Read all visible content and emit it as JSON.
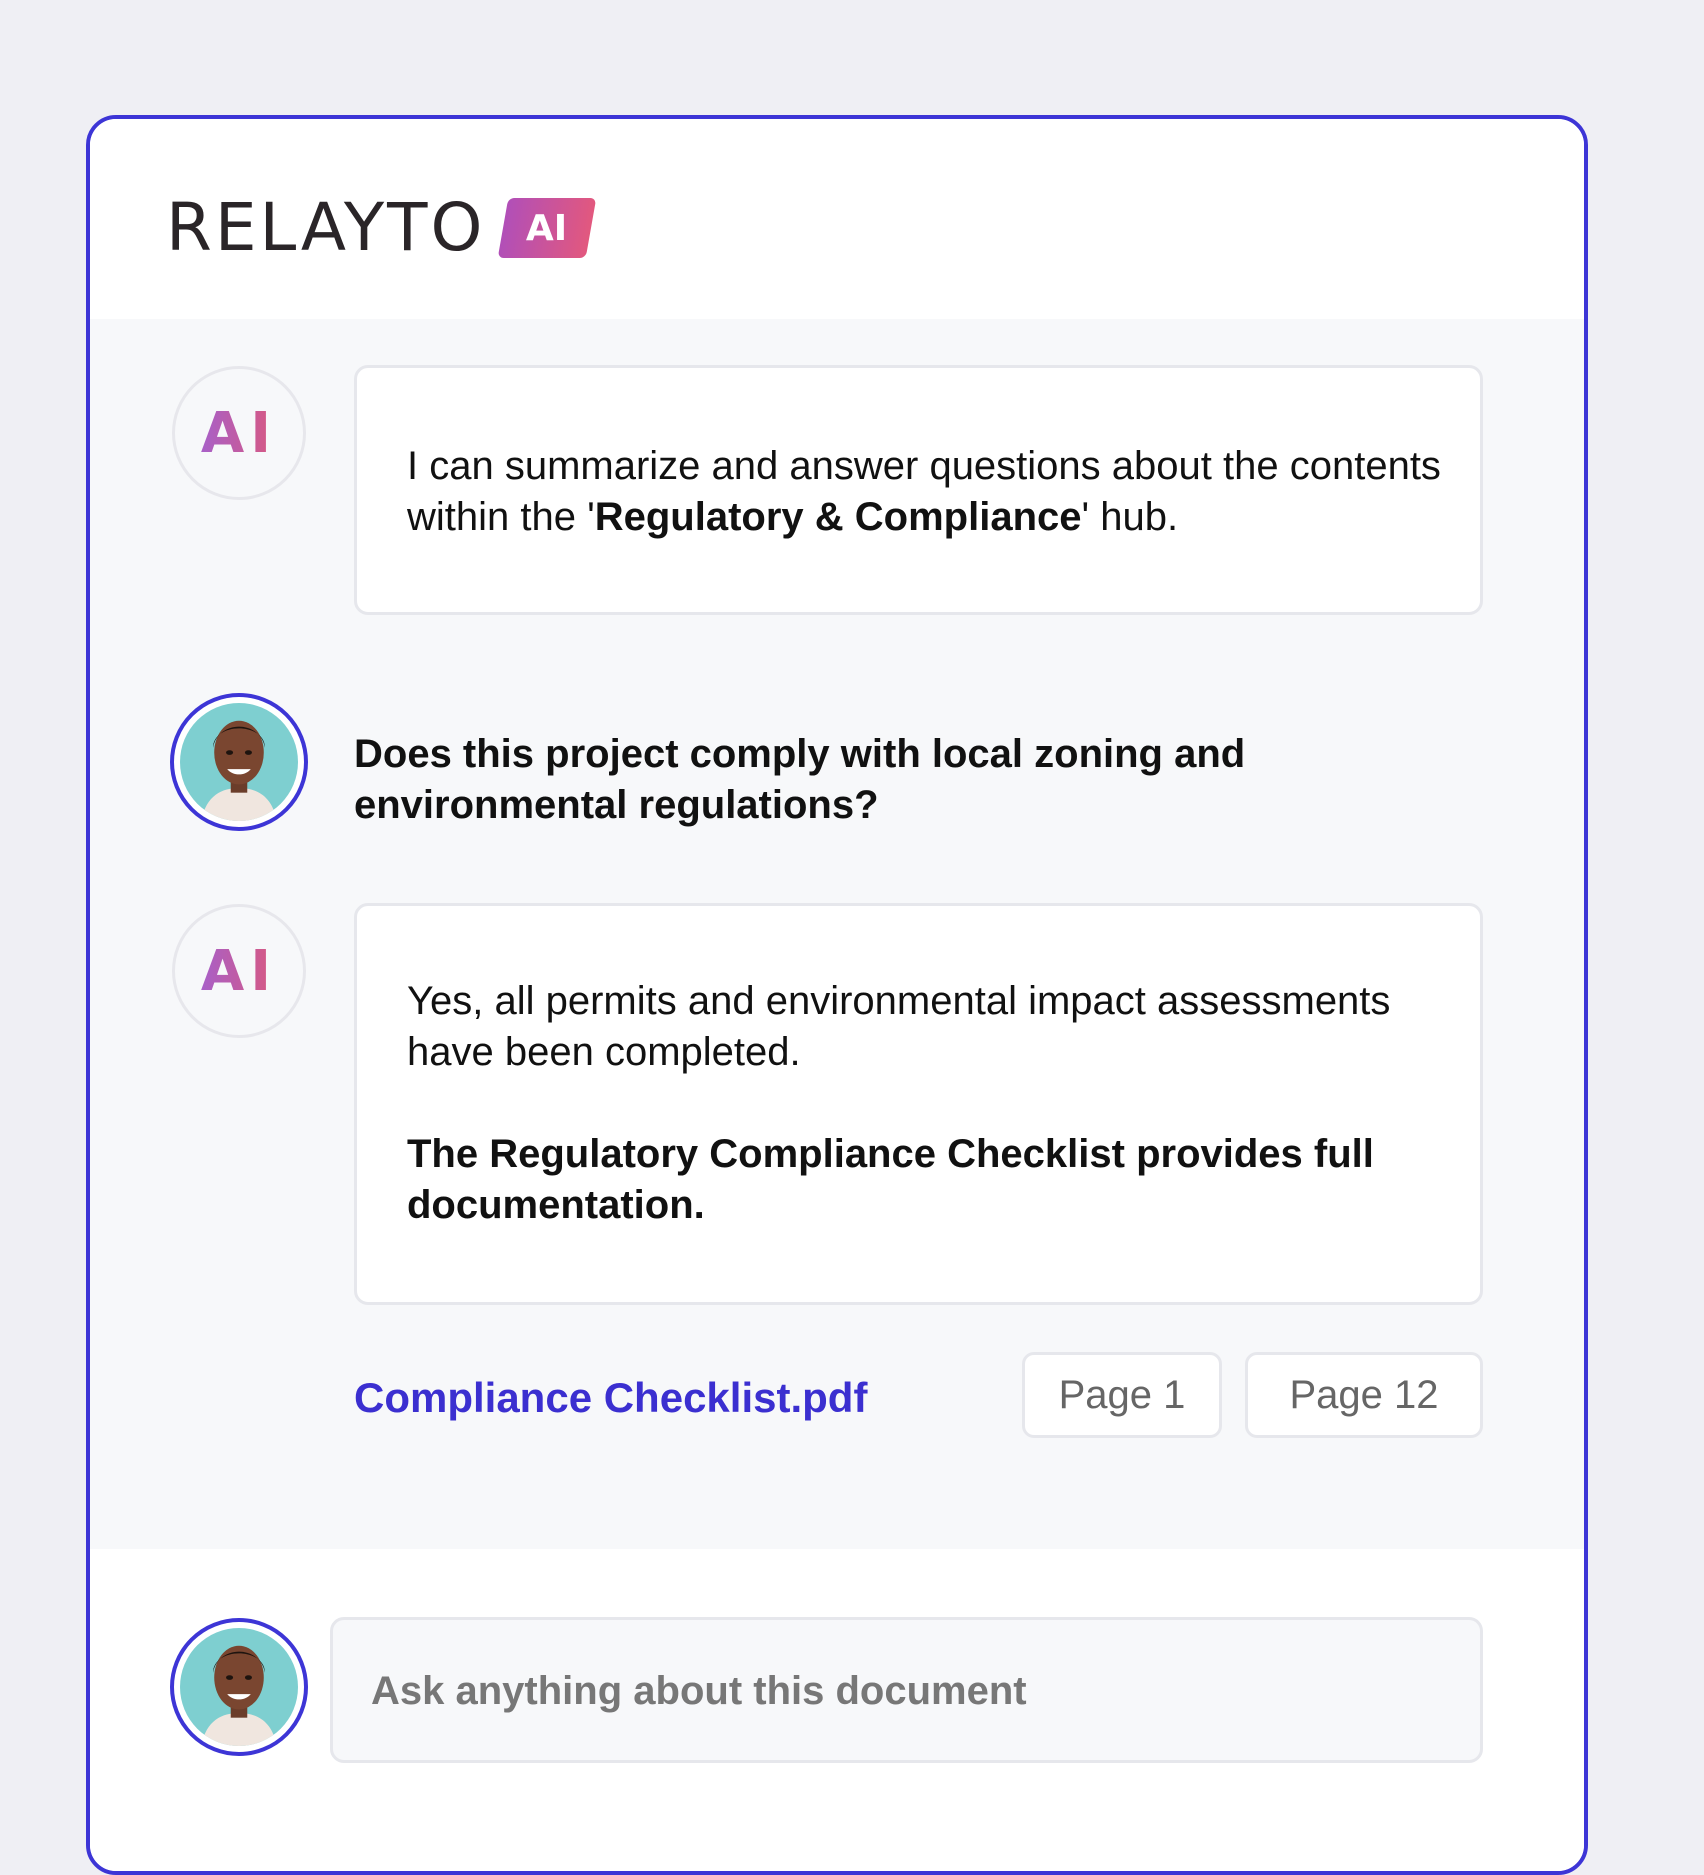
{
  "brand": {
    "name": "RELAYTO",
    "badge": "AI"
  },
  "chat": {
    "ai_avatar_label": "AI",
    "messages": [
      {
        "role": "assistant",
        "text_parts": [
          "I can summarize and answer questions about the contents within the '",
          "Regulatory & Compliance",
          "' hub."
        ]
      },
      {
        "role": "user",
        "text": "Does this project comply with local zoning and environmental regulations?"
      },
      {
        "role": "assistant",
        "text": "Yes, all permits and environmental impact assessments have been completed.",
        "bold_text": "The Regulatory Compliance Checklist provides full documentation."
      }
    ],
    "source": {
      "file_name": "Compliance Checklist.pdf",
      "pages": [
        "Page 1",
        "Page 12"
      ]
    }
  },
  "composer": {
    "placeholder": "Ask anything about this document",
    "value": ""
  },
  "colors": {
    "accent": "#3d35d6",
    "link": "#3b2fd0",
    "badge_gradient_start": "#b14fb8",
    "badge_gradient_end": "#e2587e",
    "avatar_bg": "#7ecfd0"
  }
}
